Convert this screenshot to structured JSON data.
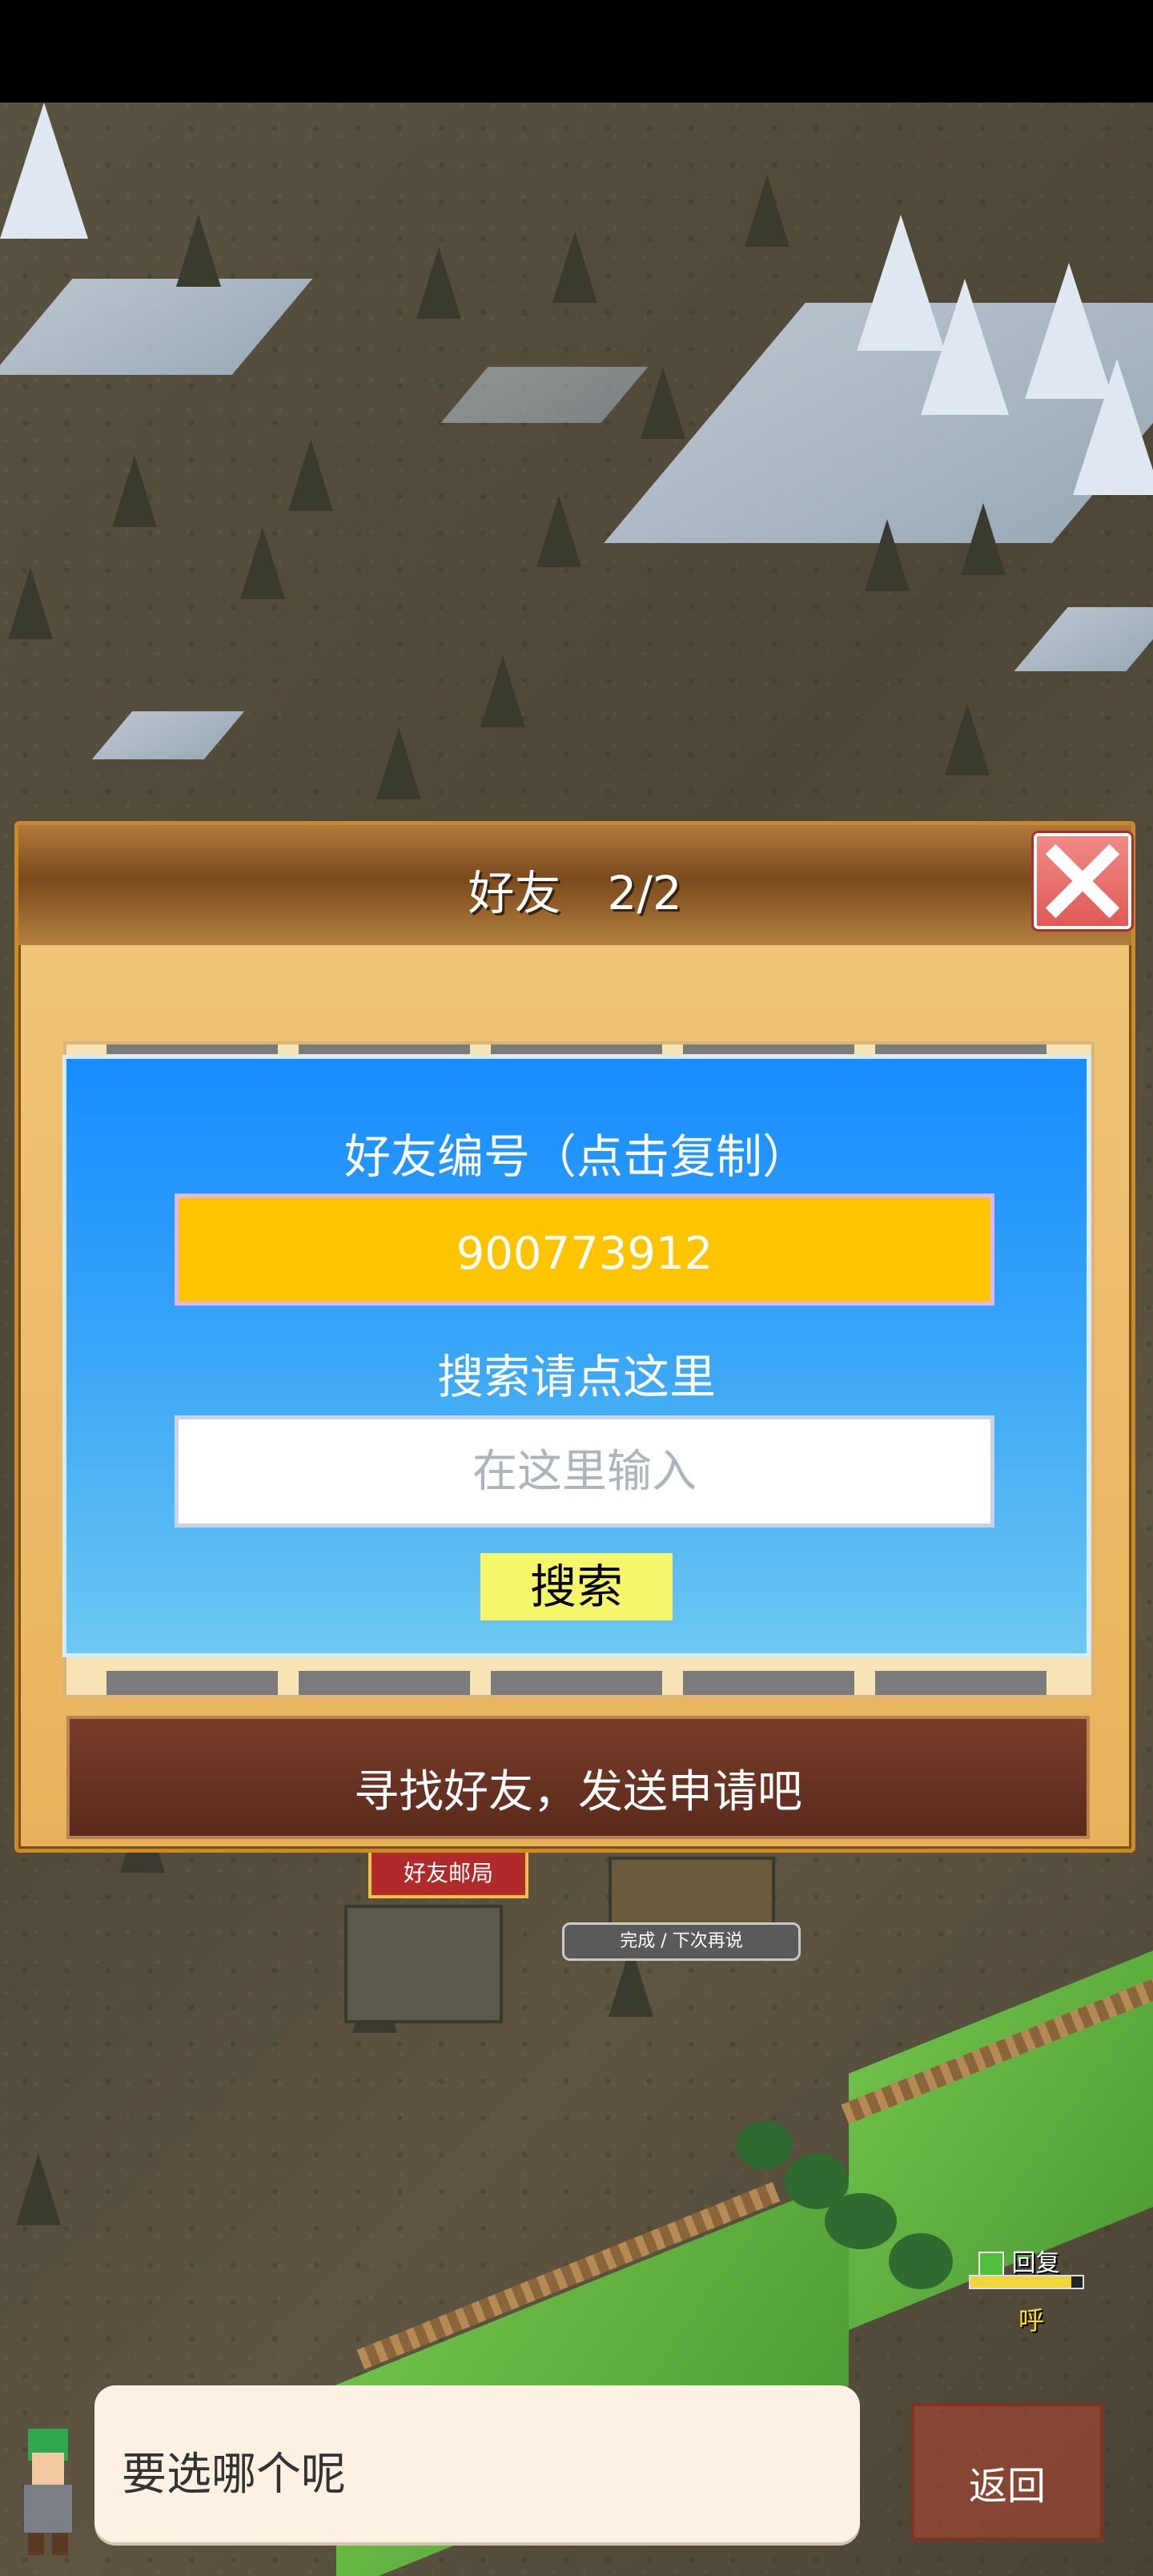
{
  "dialog": {
    "title": "好友　2/2",
    "friend_id_label": "好友编号（点击复制）",
    "friend_id_value": "900773912",
    "search_label": "搜索请点这里",
    "search_placeholder": "在这里输入",
    "search_button": "搜索",
    "footer_button": "寻找好友，发送申请吧"
  },
  "world": {
    "post_office_sign": "好友邮局",
    "done_later_button": "完成 / 下次再说",
    "recover_label": "回复",
    "status_text": "呼"
  },
  "bottom": {
    "speech": "要选哪个呢",
    "back_button": "返回"
  },
  "colors": {
    "friend_id_bg": "#ffc400",
    "card_blue": "#168cff",
    "search_button_bg": "#f6f66a",
    "close_red": "#e05a56"
  }
}
